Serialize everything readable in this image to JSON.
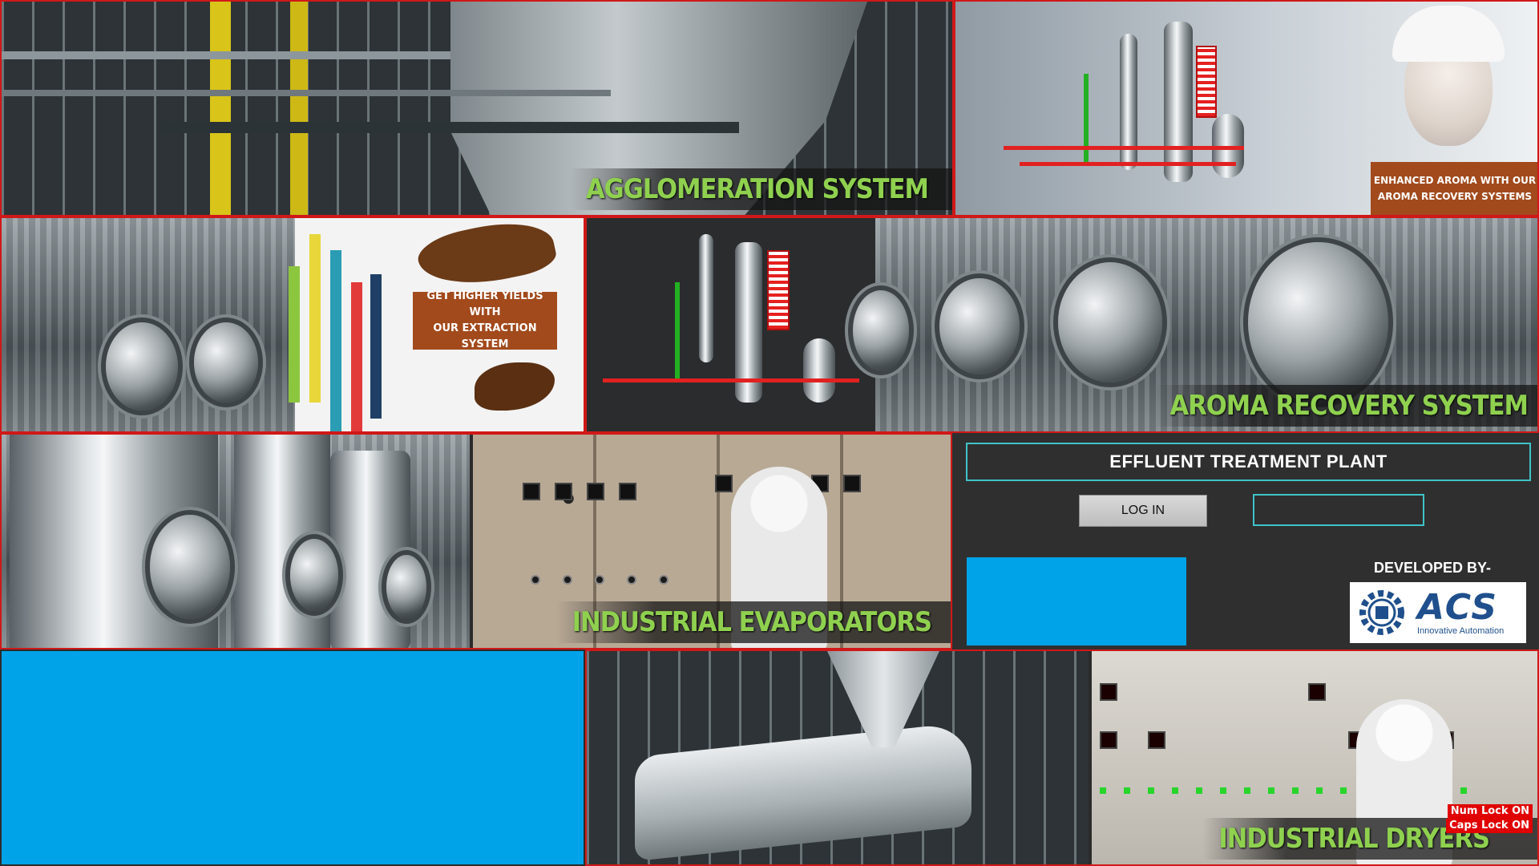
{
  "tiles": {
    "agglomeration": {
      "caption": "AGGLOMERATION SYSTEM"
    },
    "aroma_ad": {
      "banner_line1": "ENHANCED AROMA WITH OUR",
      "banner_line2": "AROMA RECOVERY SYSTEMS"
    },
    "extraction_ad": {
      "banner_line1": "GET HIGHER YIELDS WITH",
      "banner_line2": "OUR EXTRACTION SYSTEM"
    },
    "aroma_recovery": {
      "caption": "AROMA RECOVERY SYSTEM"
    },
    "evaporators": {
      "caption": "INDUSTRIAL EVAPORATORS"
    },
    "dryers": {
      "caption": "INDUSTRIAL DRYERS"
    }
  },
  "control_panel": {
    "title": "EFFLUENT TREATMENT PLANT",
    "login_label": "LOG IN",
    "user_field_value": "",
    "developed_by": "DEVELOPED BY-",
    "logo_text": "ACS",
    "logo_tagline": "Innovative Automation"
  },
  "status": {
    "num_lock": "Num Lock ON",
    "caps_lock": "Caps Lock ON"
  },
  "colors": {
    "border": "#d01818",
    "caption": "#8fd14f",
    "banner": "#a24a1c",
    "accent": "#3fc3c8",
    "blue_box": "#00a3e8"
  }
}
